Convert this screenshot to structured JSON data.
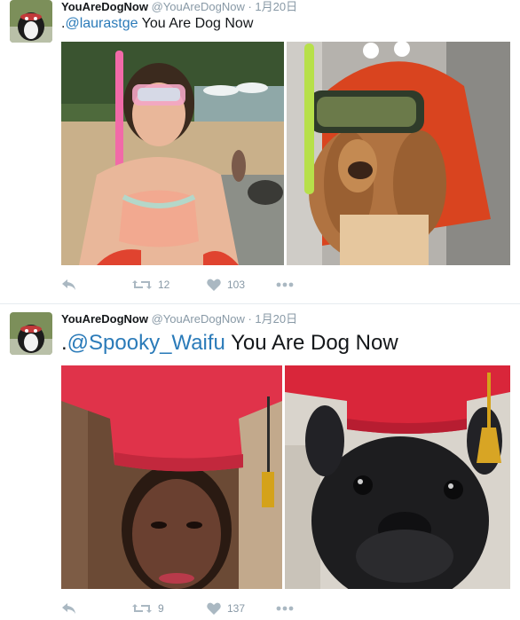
{
  "tweets": [
    {
      "user": {
        "name": "YouAreDogNow",
        "handle": "@YouAreDogNow",
        "separator": "·",
        "time": "1月20日"
      },
      "text": {
        "prefix": ".",
        "mention": "@laurastge",
        "body": " You Are Dog Now"
      },
      "stats": {
        "retweets": "12",
        "likes": "103"
      }
    },
    {
      "user": {
        "name": "YouAreDogNow",
        "handle": "@YouAreDogNow",
        "separator": "·",
        "time": "1月20日"
      },
      "text": {
        "prefix": ".",
        "mention": "@Spooky_Waifu",
        "body": " You Are Dog Now"
      },
      "stats": {
        "retweets": "9",
        "likes": "137"
      }
    }
  ],
  "icons": {
    "reply": "reply-icon",
    "retweet": "retweet-icon",
    "like": "heart-icon",
    "more": "more-icon"
  },
  "colors": {
    "mention": "#2b7bb9",
    "meta": "#8899a6",
    "icon": "#aab8c2"
  }
}
